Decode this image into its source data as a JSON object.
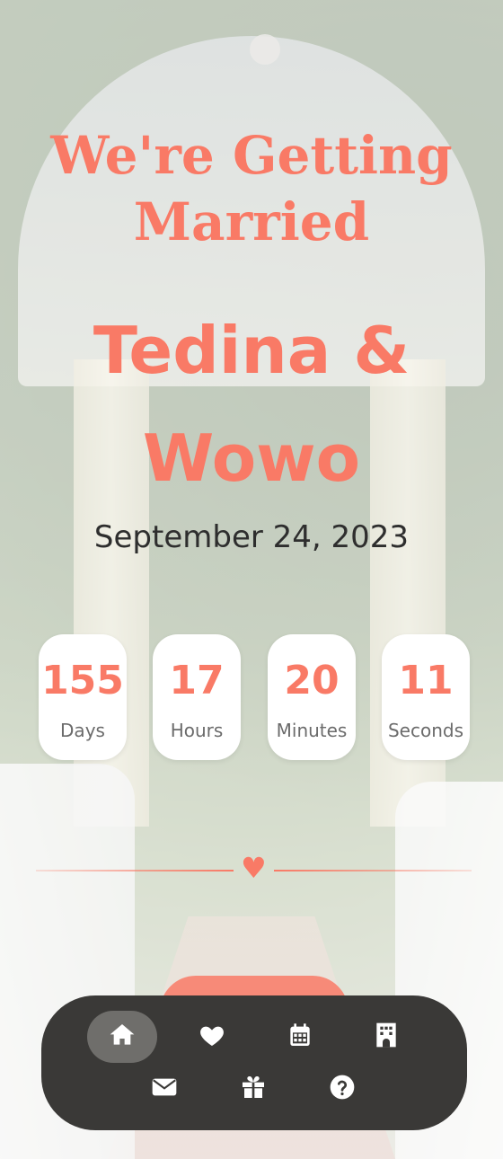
{
  "headline": {
    "line1": "We're Getting",
    "line2": "Married"
  },
  "couple": {
    "name1": "Tedina &",
    "name2": "Wowo"
  },
  "date": "September 24, 2023",
  "countdown": [
    {
      "value": "155",
      "unit": "Days"
    },
    {
      "value": "17",
      "unit": "Hours"
    },
    {
      "value": "20",
      "unit": "Minutes"
    },
    {
      "value": "11",
      "unit": "Seconds"
    }
  ],
  "divider": {
    "icon": "heart-icon"
  },
  "nav": {
    "items": [
      {
        "icon": "home-icon",
        "active": true
      },
      {
        "icon": "heart-icon",
        "active": false
      },
      {
        "icon": "calendar-icon",
        "active": false
      },
      {
        "icon": "building-icon",
        "active": false
      },
      {
        "icon": "envelope-icon",
        "active": false
      },
      {
        "icon": "gift-icon",
        "active": false
      },
      {
        "icon": "question-icon",
        "active": false
      }
    ]
  },
  "colors": {
    "accent": "#f97a66",
    "nav_bg": "#3a3937",
    "text_dark": "#2e2e2e"
  }
}
